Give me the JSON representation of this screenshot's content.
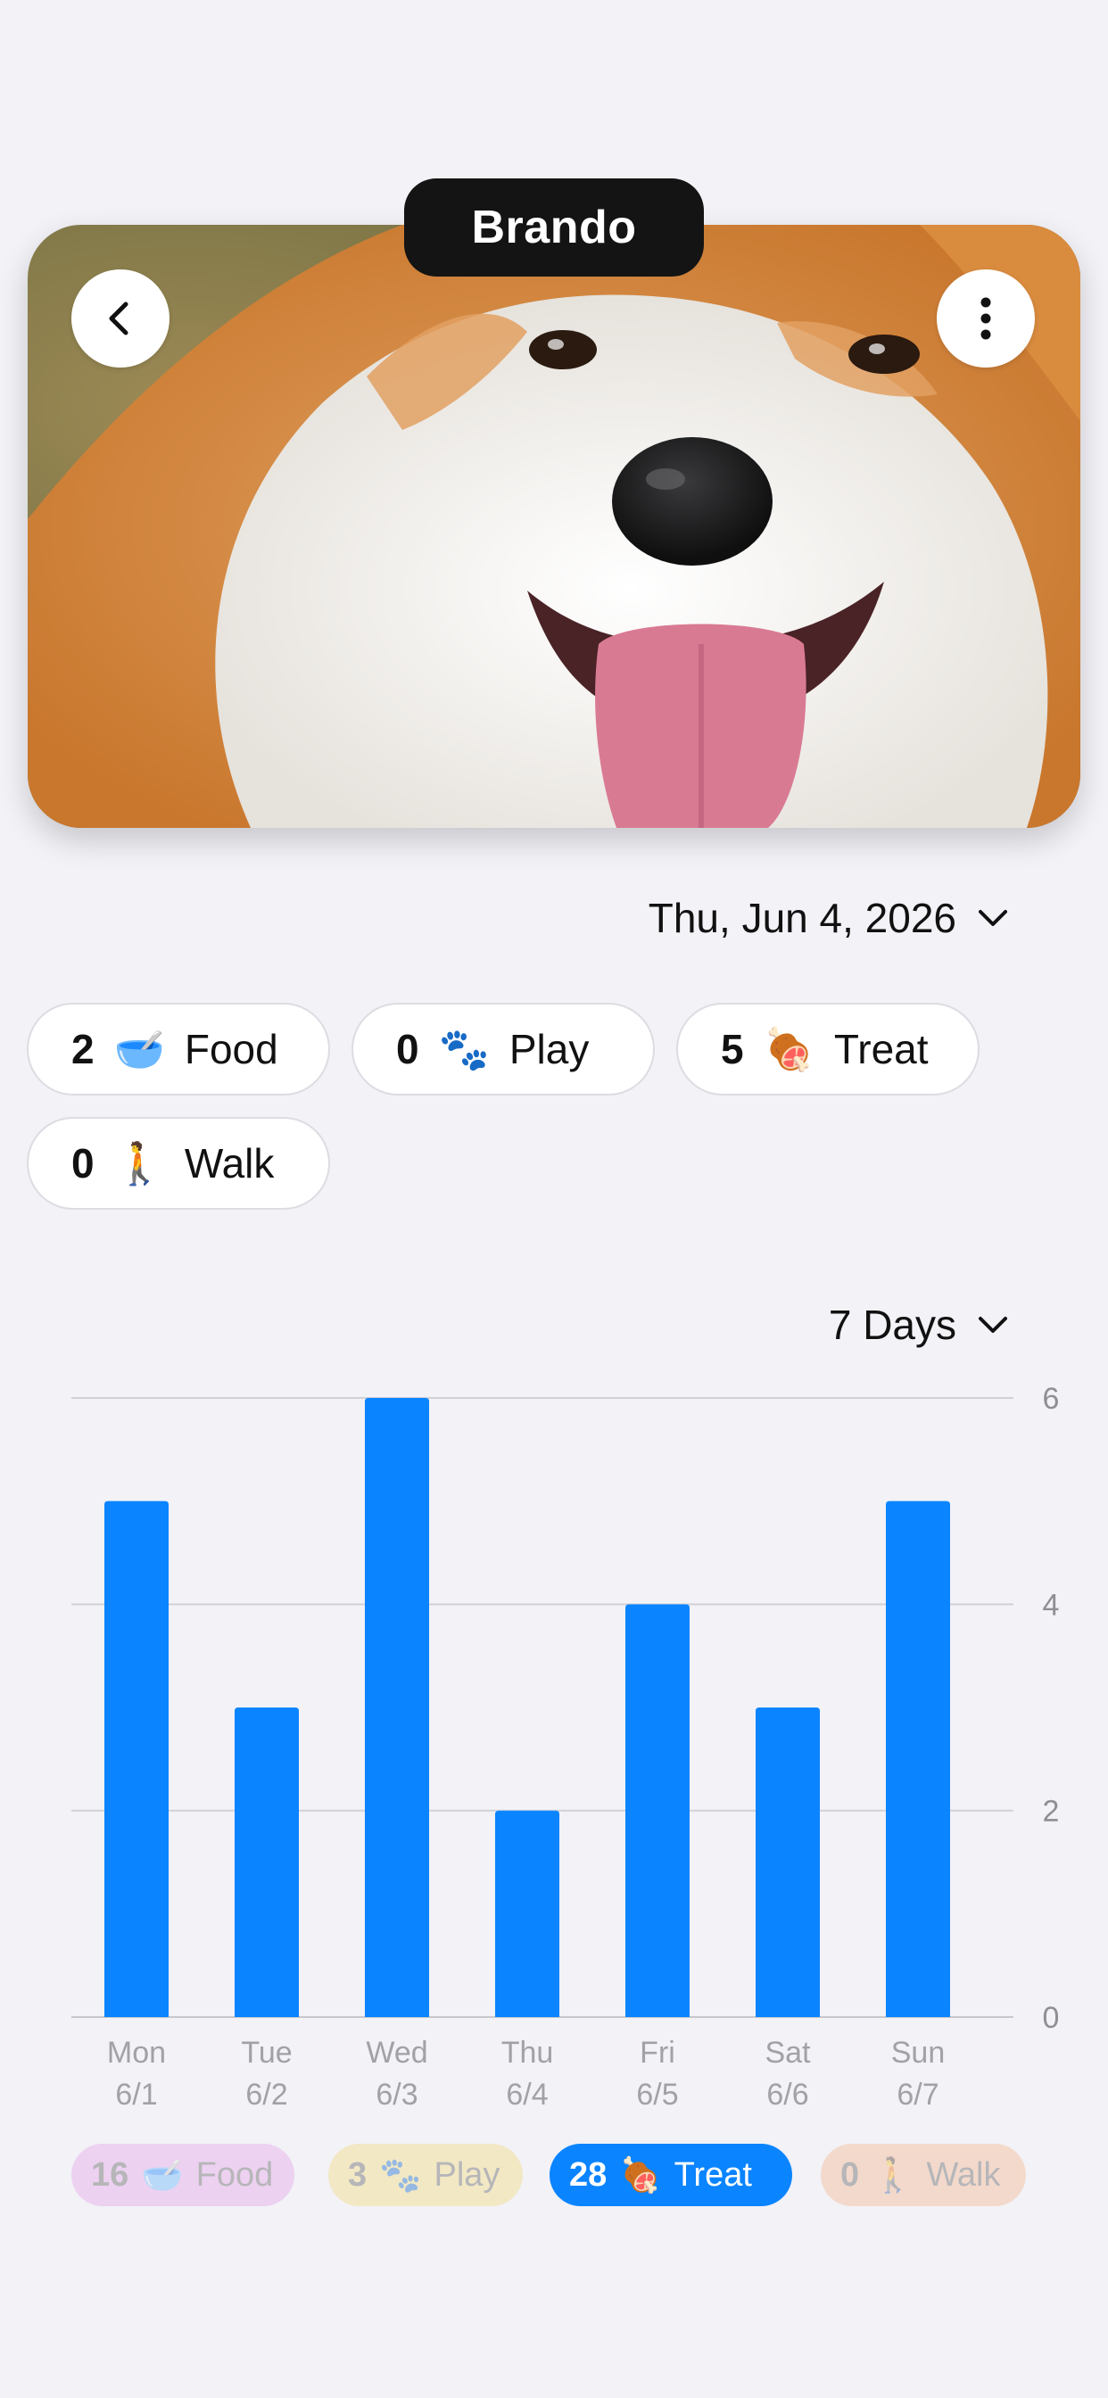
{
  "pet": {
    "name": "Brando"
  },
  "header": {
    "back_icon": "chevron-left-icon",
    "menu_icon": "ellipsis-vertical-icon"
  },
  "date_selector": {
    "label": "Thu, Jun 4, 2026",
    "icon": "chevron-down-icon"
  },
  "stats": [
    {
      "count": "2",
      "emoji": "🥣",
      "label": "Food"
    },
    {
      "count": "0",
      "emoji": "🐾",
      "label": "Play"
    },
    {
      "count": "5",
      "emoji": "🍖",
      "label": "Treat"
    },
    {
      "count": "0",
      "emoji": "🚶",
      "label": "Walk"
    }
  ],
  "range_selector": {
    "label": "7 Days",
    "icon": "chevron-down-icon"
  },
  "chart_data": {
    "type": "bar",
    "categories": [
      "Mon 6/1",
      "Tue 6/2",
      "Wed 6/3",
      "Thu 6/4",
      "Fri 6/5",
      "Sat 6/6",
      "Sun 6/7"
    ],
    "day_labels": [
      "Mon",
      "Tue",
      "Wed",
      "Thu",
      "Fri",
      "Sat",
      "Sun"
    ],
    "date_labels": [
      "6/1",
      "6/2",
      "6/3",
      "6/4",
      "6/5",
      "6/6",
      "6/7"
    ],
    "series": [
      {
        "name": "Treat",
        "values": [
          5,
          3,
          6,
          2,
          4,
          3,
          5
        ],
        "color": "#0a84ff"
      }
    ],
    "ylim": [
      0,
      6
    ],
    "yticks": [
      0,
      2,
      4,
      6
    ],
    "y_axis_side": "right",
    "grid": true
  },
  "legend": [
    {
      "count": "16",
      "emoji": "🥣",
      "label": "Food",
      "color": "#e7a6ea",
      "active": false
    },
    {
      "count": "3",
      "emoji": "🐾",
      "label": "Play",
      "color": "#f3dc80",
      "active": false
    },
    {
      "count": "28",
      "emoji": "🍖",
      "label": "Treat",
      "color": "#0a84ff",
      "active": true
    },
    {
      "count": "0",
      "emoji": "🚶",
      "label": "Walk",
      "color": "#f5b98f",
      "active": false
    }
  ]
}
